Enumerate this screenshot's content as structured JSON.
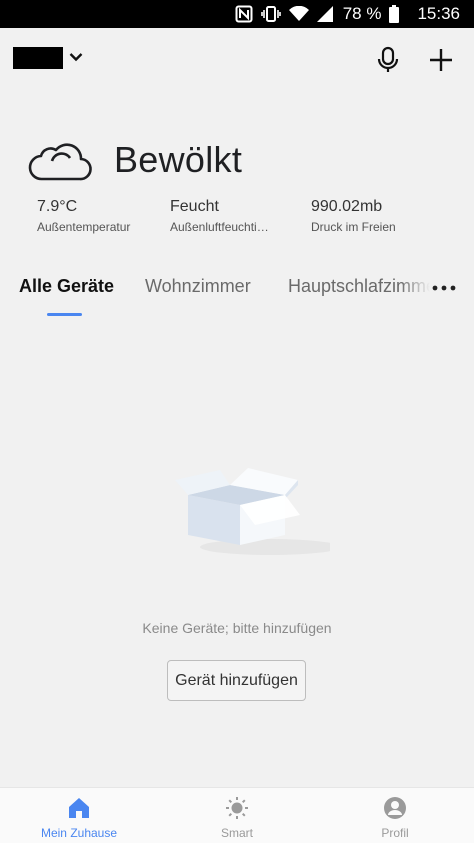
{
  "status_bar": {
    "battery_percent": "78 %",
    "time": "15:36",
    "icons": [
      "nfc-icon",
      "vibrate-icon",
      "wifi-icon",
      "signal-icon",
      "battery-icon"
    ]
  },
  "header": {
    "home_selector_icon": "chevron-down-icon",
    "mic_icon": "microphone-icon",
    "add_icon": "plus-icon"
  },
  "weather": {
    "condition": "Bewölkt",
    "icon": "cloud-icon",
    "stats": [
      {
        "value": "7.9°C",
        "label": "Außentemperatur"
      },
      {
        "value": "Feucht",
        "label": "Außenluftfeuchti…"
      },
      {
        "value": "990.02mb",
        "label": "Druck im Freien"
      }
    ]
  },
  "tabs": {
    "items": [
      {
        "label": "Alle Geräte",
        "active": true
      },
      {
        "label": "Wohnzimmer",
        "active": false
      },
      {
        "label": "Hauptschlafzimmer",
        "active": false
      }
    ],
    "more_icon": "more-dots-icon"
  },
  "empty_state": {
    "message": "Keine Geräte; bitte hinzufügen",
    "button_label": "Gerät hinzufügen"
  },
  "bottom_nav": {
    "items": [
      {
        "label": "Mein Zuhause",
        "icon": "home-icon",
        "active": true
      },
      {
        "label": "Smart",
        "icon": "sun-icon",
        "active": false
      },
      {
        "label": "Profil",
        "icon": "profile-icon",
        "active": false
      }
    ]
  },
  "colors": {
    "accent": "#4a86f0",
    "background": "#f1f1f1",
    "status_bar": "#000000"
  }
}
